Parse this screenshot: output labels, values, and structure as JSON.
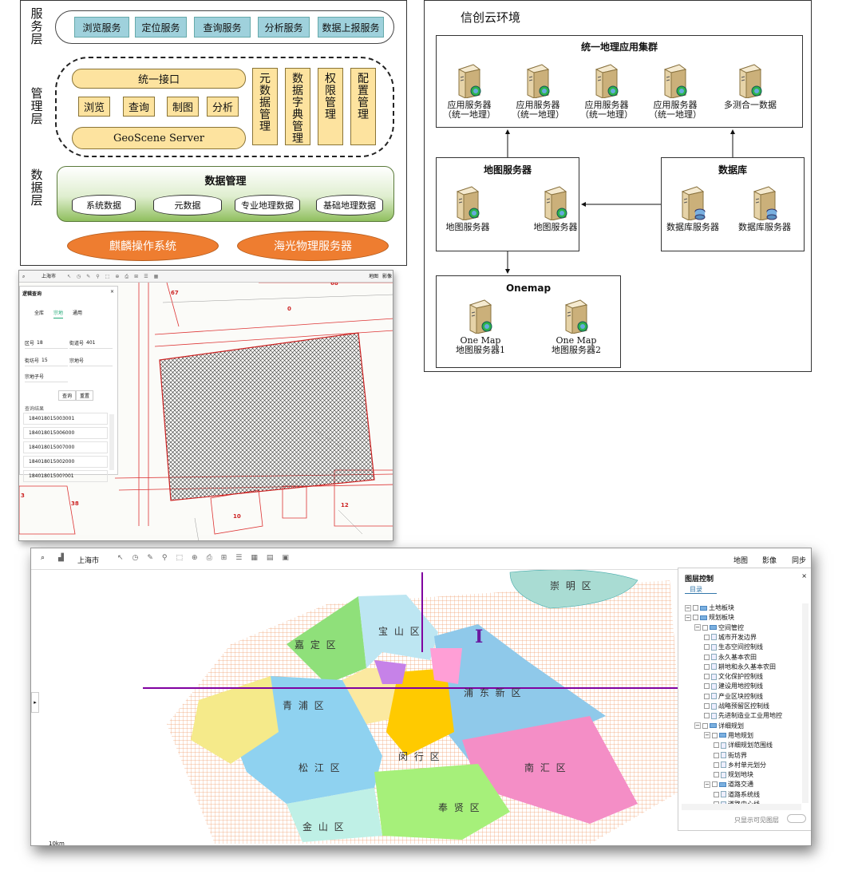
{
  "arch": {
    "layers": {
      "service": "服\n务\n层",
      "manage": "管\n理\n层",
      "data": "数\n据\n层"
    },
    "services": [
      "浏览服务",
      "定位服务",
      "查询服务",
      "分析服务",
      "数据上报服务"
    ],
    "unified": "统一接口",
    "funcs": [
      "浏览",
      "查询",
      "制图",
      "分析"
    ],
    "server": "GeoScene Server",
    "mgmt": [
      "元\n数\n据\n管\n理",
      "数\n据\n字\n典\n管\n理",
      "权\n限\n管\n理",
      "配\n置\n管\n理"
    ],
    "data_title": "数据管理",
    "data_items": [
      "系统数据",
      "元数据",
      "专业地理数据",
      "基础地理数据"
    ],
    "os": "麒麟操作系统",
    "hw": "海光物理服务器"
  },
  "cloud": {
    "title": "信创云环境",
    "cluster": "统一地理应用集群",
    "cluster_servers": [
      {
        "l1": "应用服务器",
        "l2": "（统一地理）"
      },
      {
        "l1": "应用服务器",
        "l2": "（统一地理）"
      },
      {
        "l1": "应用服务器",
        "l2": "（统一地理）"
      },
      {
        "l1": "应用服务器",
        "l2": "（统一地理）"
      },
      {
        "l1": "多测合一数据",
        "l2": ""
      }
    ],
    "map_title": "地图服务器",
    "map_servers": [
      "地图服务器",
      "地图服务器"
    ],
    "db_title": "数据库",
    "db_servers": [
      "数据库服务器",
      "数据库服务器"
    ],
    "onemap_title": "Onemap",
    "onemap_servers": [
      {
        "l1": "One Map",
        "l2": "地图服务器1"
      },
      {
        "l1": "One Map",
        "l2": "地图服务器2"
      }
    ]
  },
  "shot1": {
    "toolbar": {
      "city": "上海市",
      "map": "地图",
      "image": "影像"
    },
    "panel_title": "逻辑查询",
    "tabs": [
      "全库",
      "宗地",
      "通用"
    ],
    "fields": [
      {
        "label": "区号",
        "value": "18"
      },
      {
        "label": "街道号",
        "value": "401"
      },
      {
        "label": "街坊号",
        "value": "15"
      },
      {
        "label": "宗地号",
        "value": ""
      },
      {
        "label": "宗地子号",
        "value": ""
      }
    ],
    "buttons": [
      "查询",
      "重置"
    ],
    "result_label": "查询结果",
    "results": [
      "184018015003001",
      "184018015006000",
      "184018015007000",
      "184018015002000",
      "18401801500?001"
    ],
    "parcel_labels": [
      "67",
      "68",
      "0",
      "10",
      "12",
      "38",
      "3"
    ]
  },
  "shot2": {
    "toolbar": {
      "city": "上海市",
      "map": "地图",
      "image": "影像",
      "sync": "同步"
    },
    "panel_title": "图层控制",
    "catalog": "目录",
    "tree": [
      {
        "t": "土地板块",
        "d": 0
      },
      {
        "t": "规划板块",
        "d": 0
      },
      {
        "t": "空间管控",
        "d": 1
      },
      {
        "t": "城市开发边界",
        "d": 2
      },
      {
        "t": "生态空间控制线",
        "d": 2
      },
      {
        "t": "永久基本农田",
        "d": 2
      },
      {
        "t": "耕地和永久基本农田",
        "d": 2
      },
      {
        "t": "文化保护控制线",
        "d": 2
      },
      {
        "t": "建设用地控制线",
        "d": 2
      },
      {
        "t": "产业区块控制线",
        "d": 2
      },
      {
        "t": "战略预留区控制线",
        "d": 2
      },
      {
        "t": "先进制造业工业用地控",
        "d": 2
      },
      {
        "t": "详细规划",
        "d": 1
      },
      {
        "t": "用地规划",
        "d": 2
      },
      {
        "t": "详细规划范围线",
        "d": 3
      },
      {
        "t": "街坊界",
        "d": 3
      },
      {
        "t": "乡村单元划分",
        "d": 3
      },
      {
        "t": "规划地块",
        "d": 3
      },
      {
        "t": "道路交通",
        "d": 2
      },
      {
        "t": "道路系统线",
        "d": 3
      },
      {
        "t": "道路中心线",
        "d": 3
      }
    ],
    "visible_only": "只显示可见图层",
    "districts": [
      "崇 明 区",
      "嘉 定 区",
      "宝 山 区",
      "青 浦 区",
      "浦 东 新 区",
      "松 江 区",
      "闵 行 区",
      "南 汇 区",
      "奉 贤 区",
      "金 山 区"
    ],
    "scale": "10km"
  }
}
